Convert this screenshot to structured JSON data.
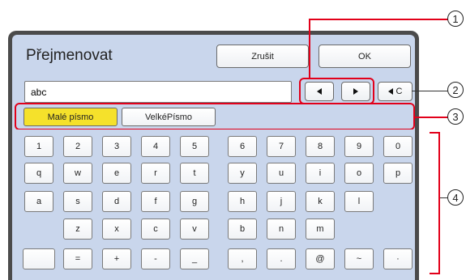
{
  "dialog": {
    "title": "Přejmenovat",
    "cancel_label": "Zrušit",
    "ok_label": "OK"
  },
  "input": {
    "value": "abc"
  },
  "cursor": {
    "clear_label": "C"
  },
  "mode": {
    "lower_label": "Malé písmo",
    "upper_label": "VelkéPísmo",
    "active": "lower",
    "active_color": "#f5e12b"
  },
  "keys": {
    "row1": [
      "1",
      "2",
      "3",
      "4",
      "5",
      "6",
      "7",
      "8",
      "9",
      "0"
    ],
    "row2": [
      "q",
      "w",
      "e",
      "r",
      "t",
      "y",
      "u",
      "i",
      "o",
      "p"
    ],
    "row3": [
      "a",
      "s",
      "d",
      "f",
      "g",
      "h",
      "j",
      "k",
      "l"
    ],
    "row4": [
      "z",
      "x",
      "c",
      "v",
      "b",
      "n",
      "m"
    ],
    "row5": [
      "",
      "=",
      "+",
      "-",
      "_",
      ",",
      ".",
      "@",
      "~",
      "·"
    ]
  },
  "callouts": [
    "1",
    "2",
    "3",
    "4"
  ],
  "colors": {
    "highlight": "#e2001a",
    "panel": "#c9d6ec"
  }
}
